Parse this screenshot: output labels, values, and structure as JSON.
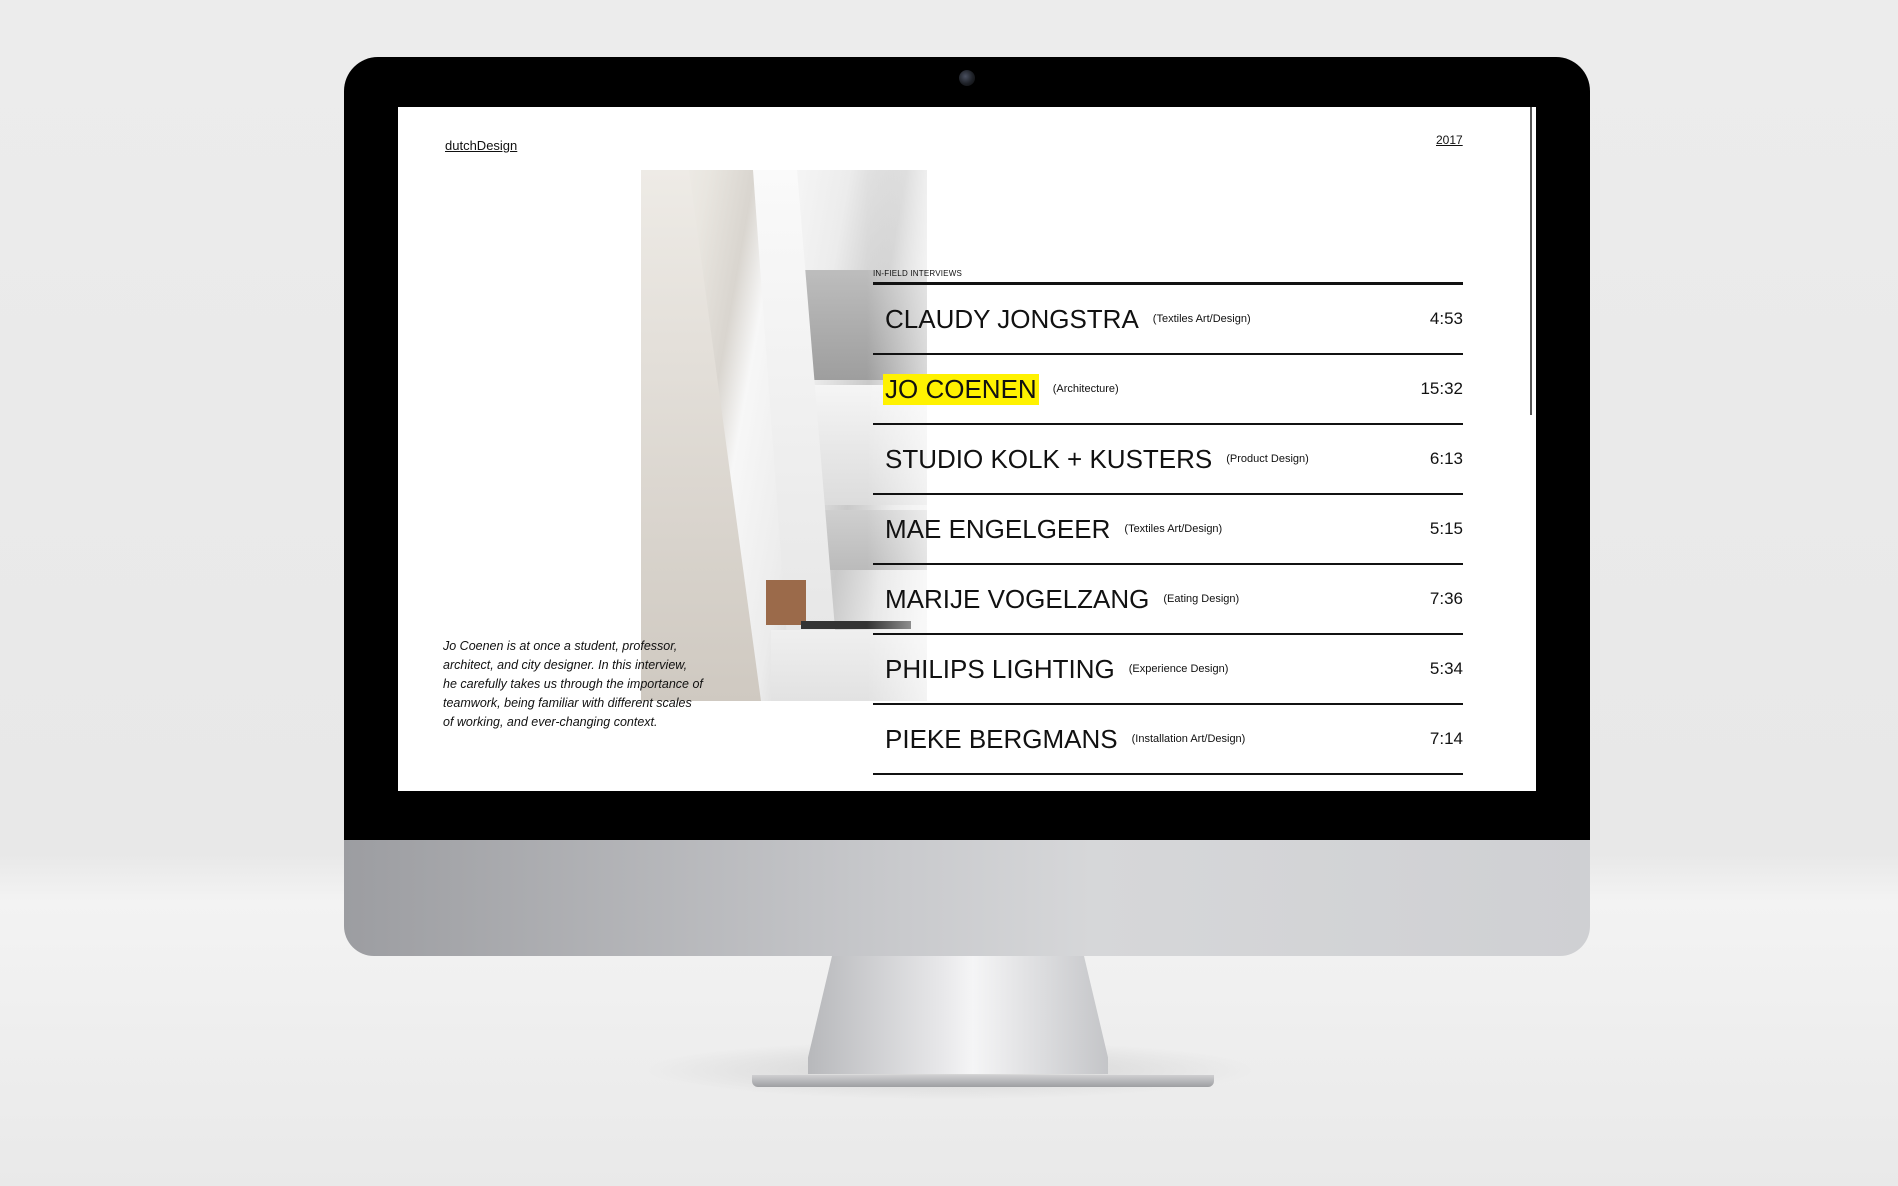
{
  "site": {
    "logo": "dutchDesign",
    "year": "2017"
  },
  "section_label": "IN-FIELD INTERVIEWS",
  "intro": "Jo Coenen is at once a student, professor, architect, and city designer. In this interview, he carefully takes us through the importance of teamwork, being familiar with different scales of working, and ever-changing context.",
  "highlight_color": "#fff200",
  "interviews": [
    {
      "name": "CLAUDY JONGSTRA",
      "category": "(Textiles Art/Design)",
      "duration": "4:53",
      "highlighted": false
    },
    {
      "name": "JO COENEN",
      "category": "(Architecture)",
      "duration": "15:32",
      "highlighted": true
    },
    {
      "name": "STUDIO KOLK + KUSTERS",
      "category": "(Product Design)",
      "duration": "6:13",
      "highlighted": false
    },
    {
      "name": "MAE ENGELGEER",
      "category": "(Textiles Art/Design)",
      "duration": "5:15",
      "highlighted": false
    },
    {
      "name": "MARIJE VOGELZANG",
      "category": "(Eating Design)",
      "duration": "7:36",
      "highlighted": false
    },
    {
      "name": "PHILIPS LIGHTING",
      "category": "(Experience Design)",
      "duration": "5:34",
      "highlighted": false
    },
    {
      "name": "PIEKE BERGMANS",
      "category": "(Installation Art/Design)",
      "duration": "7:14",
      "highlighted": false
    }
  ]
}
